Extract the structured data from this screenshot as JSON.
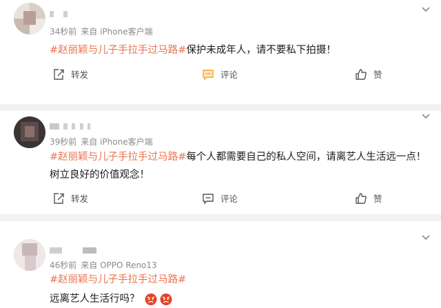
{
  "posts": [
    {
      "time": "34秒前",
      "source": "来自 iPhone客户端",
      "hashtag": "#赵丽颖与儿子手拉手过马路#",
      "text": "保护未成年人，请不要私下拍摄！",
      "actions": {
        "repost": "转发",
        "comment": "评论",
        "like": "赞"
      }
    },
    {
      "time": "39秒前",
      "source": "来自 iPhone客户端",
      "hashtag": "#赵丽颖与儿子手拉手过马路#",
      "text": "每个人都需要自己的私人空间，请离艺人生活远一点！ 树立良好的价值观念！",
      "actions": {
        "repost": "转发",
        "comment": "评论",
        "like": "赞"
      }
    },
    {
      "time": "46秒前",
      "source": "来自 OPPO Reno13",
      "hashtag": "#赵丽颖与儿子手拉手过马路#",
      "text": "远离艺人生活行吗？",
      "emoji": [
        "angry-face-emoji",
        "angry-face-emoji"
      ]
    }
  ],
  "colors": {
    "hashtag": "#eb7350",
    "meta": "#8a8a8a",
    "separator": "#f2f2f2",
    "comment_icon": "#f5a623"
  }
}
